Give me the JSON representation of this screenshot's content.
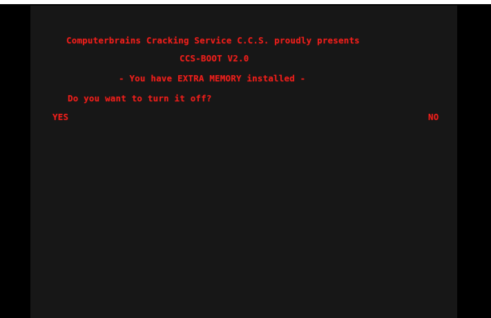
{
  "boot_screen": {
    "presents_line": "Computerbrains Cracking Service C.C.S. proudly presents",
    "version_line": "CCS-BOOT V2.0",
    "memory_notice": "- You have EXTRA MEMORY installed -",
    "question": "Do you want to turn it off?",
    "yes_option": "YES",
    "no_option": "NO"
  },
  "colors": {
    "text": "#e8201c",
    "screen_background": "#171717",
    "border": "#000000",
    "top_bar": "#ffffff"
  }
}
